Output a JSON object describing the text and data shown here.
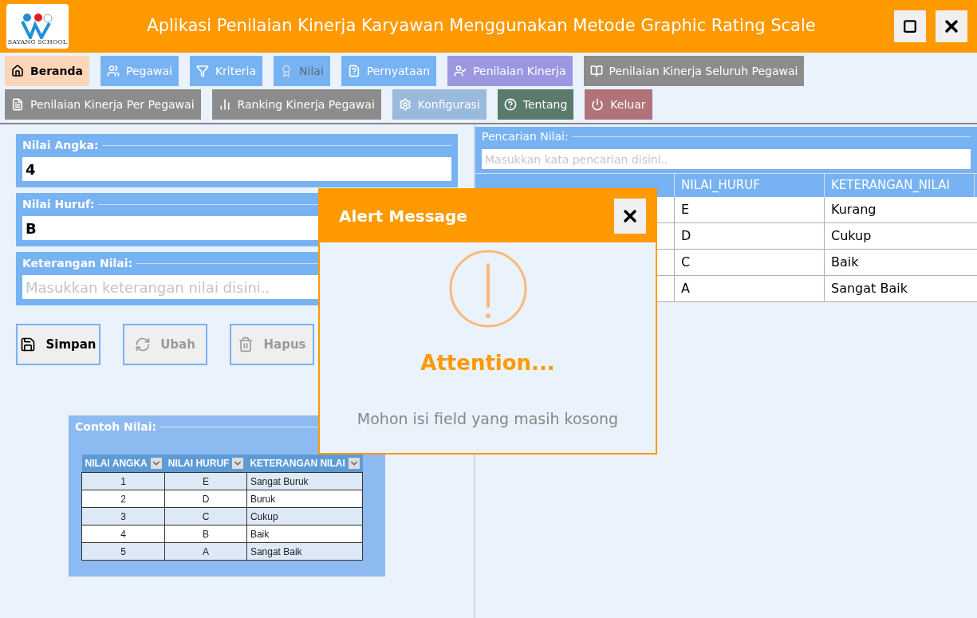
{
  "window": {
    "title": "Aplikasi Penilaian Kinerja Karyawan Menggunakan Metode Graphic Rating Scale",
    "logo_text": "SAYANG SCHOOL"
  },
  "nav": [
    [
      {
        "label": "Beranda",
        "color": "#fdd5b8",
        "disabled": false
      },
      {
        "label": "Pegawai",
        "color": "#77b2f3",
        "disabled": false
      },
      {
        "label": "Kriteria",
        "color": "#77b2f3",
        "disabled": false
      },
      {
        "label": "Nilai",
        "color": "#77b2f3",
        "disabled": true
      },
      {
        "label": "Pernyataan",
        "color": "#77b2f3",
        "disabled": false
      },
      {
        "label": "Penilaian Kinerja",
        "color": "#9b97e0",
        "disabled": false
      },
      {
        "label": "Penilaian Kinerja Seluruh Pegawai",
        "color": "#8c8c8c",
        "disabled": false
      }
    ],
    [
      {
        "label": "Penilaian Kinerja Per Pegawai",
        "color": "#8c8c8c",
        "disabled": false
      },
      {
        "label": "Ranking Kinerja Pegawai",
        "color": "#8c8c8c",
        "disabled": false
      },
      {
        "label": "Konfigurasi",
        "color": "#99b9dd",
        "disabled": false
      },
      {
        "label": "Tentang",
        "color": "#5a7a6c",
        "disabled": false
      },
      {
        "label": "Keluar",
        "color": "#b0737a",
        "disabled": false
      }
    ]
  ],
  "form": {
    "fields": [
      {
        "label": "Nilai Angka:",
        "value": "4"
      },
      {
        "label": "Nilai Huruf:",
        "value": "B"
      },
      {
        "label": "Keterangan Nilai:",
        "placeholder": "Masukkan keterangan nilai disini.."
      }
    ],
    "buttons": [
      {
        "label": "Simpan",
        "disabled": false
      },
      {
        "label": "Ubah",
        "disabled": true
      },
      {
        "label": "Hapus",
        "disabled": true
      }
    ]
  },
  "example": {
    "title": "Contoh Nilai:",
    "columns": [
      "NILAI ANGKA",
      "NILAI HURUF",
      "KETERANGAN NILAI"
    ],
    "rows": [
      [
        "1",
        "E",
        "Sangat Buruk"
      ],
      [
        "2",
        "D",
        "Buruk"
      ],
      [
        "3",
        "C",
        "Cukup"
      ],
      [
        "4",
        "B",
        "Baik"
      ],
      [
        "5",
        "A",
        "Sangat Baik"
      ]
    ]
  },
  "search": {
    "title": "Pencarian Nilai:",
    "placeholder": "Masukkan kata pencarian disini.."
  },
  "table": {
    "columns": [
      "NILAI_HURUF",
      "KETERANGAN_NILAI"
    ],
    "rows": [
      {
        "nilai_huruf": "E",
        "keterangan_nilai": "Kurang"
      },
      {
        "nilai_huruf": "D",
        "keterangan_nilai": "Cukup"
      },
      {
        "nilai_huruf": "C",
        "keterangan_nilai": "Baik"
      },
      {
        "nilai_huruf": "A",
        "keterangan_nilai": "Sangat Baik"
      }
    ]
  },
  "dialog": {
    "title": "Alert Message",
    "heading": "Attention...",
    "message": "Mohon isi field yang masih kosong"
  }
}
